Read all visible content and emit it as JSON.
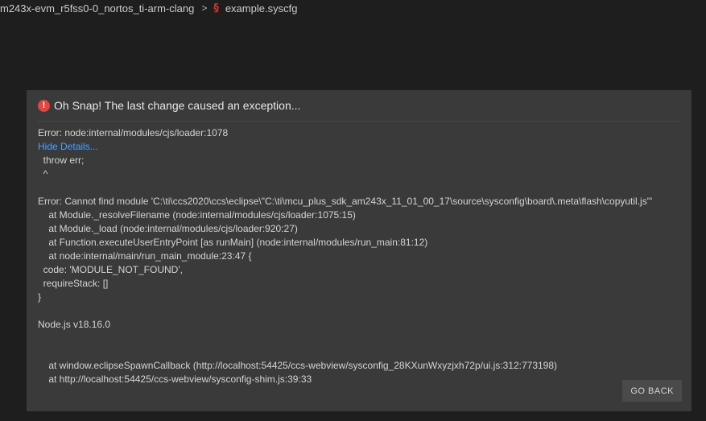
{
  "breadcrumb": {
    "project": "m243x-evm_r5fss0-0_nortos_ti-arm-clang",
    "separator": ">",
    "file_icon": "syscfg-icon",
    "file": "example.syscfg"
  },
  "dialog": {
    "title": "Oh Snap! The last change caused an exception...",
    "error_location": "Error: node:internal/modules/cjs/loader:1078",
    "toggle_details": "Hide Details...",
    "details": [
      "  throw err;",
      "  ^",
      "",
      "Error: Cannot find module 'C:\\ti\\ccs2020\\ccs\\eclipse\\\"C:\\ti\\mcu_plus_sdk_am243x_11_01_00_17\\source\\sysconfig\\board\\.meta\\flash\\copyutil.js\"'",
      "    at Module._resolveFilename (node:internal/modules/cjs/loader:1075:15)",
      "    at Module._load (node:internal/modules/cjs/loader:920:27)",
      "    at Function.executeUserEntryPoint [as runMain] (node:internal/modules/run_main:81:12)",
      "    at node:internal/main/run_main_module:23:47 {",
      "  code: 'MODULE_NOT_FOUND',",
      "  requireStack: []",
      "}",
      "",
      "Node.js v18.16.0",
      "",
      "",
      "    at window.eclipseSpawnCallback (http://localhost:54425/ccs-webview/sysconfig_28KXunWxyzjxh72p/ui.js:312:773198)",
      "    at http://localhost:54425/ccs-webview/sysconfig-shim.js:39:33"
    ],
    "go_back_label": "GO BACK"
  },
  "colors": {
    "background": "#1e1e1e",
    "dialog": "#3a3a3a",
    "error_icon": "#e2453c",
    "link": "#4da0ff",
    "file_icon": "#d0342c"
  }
}
